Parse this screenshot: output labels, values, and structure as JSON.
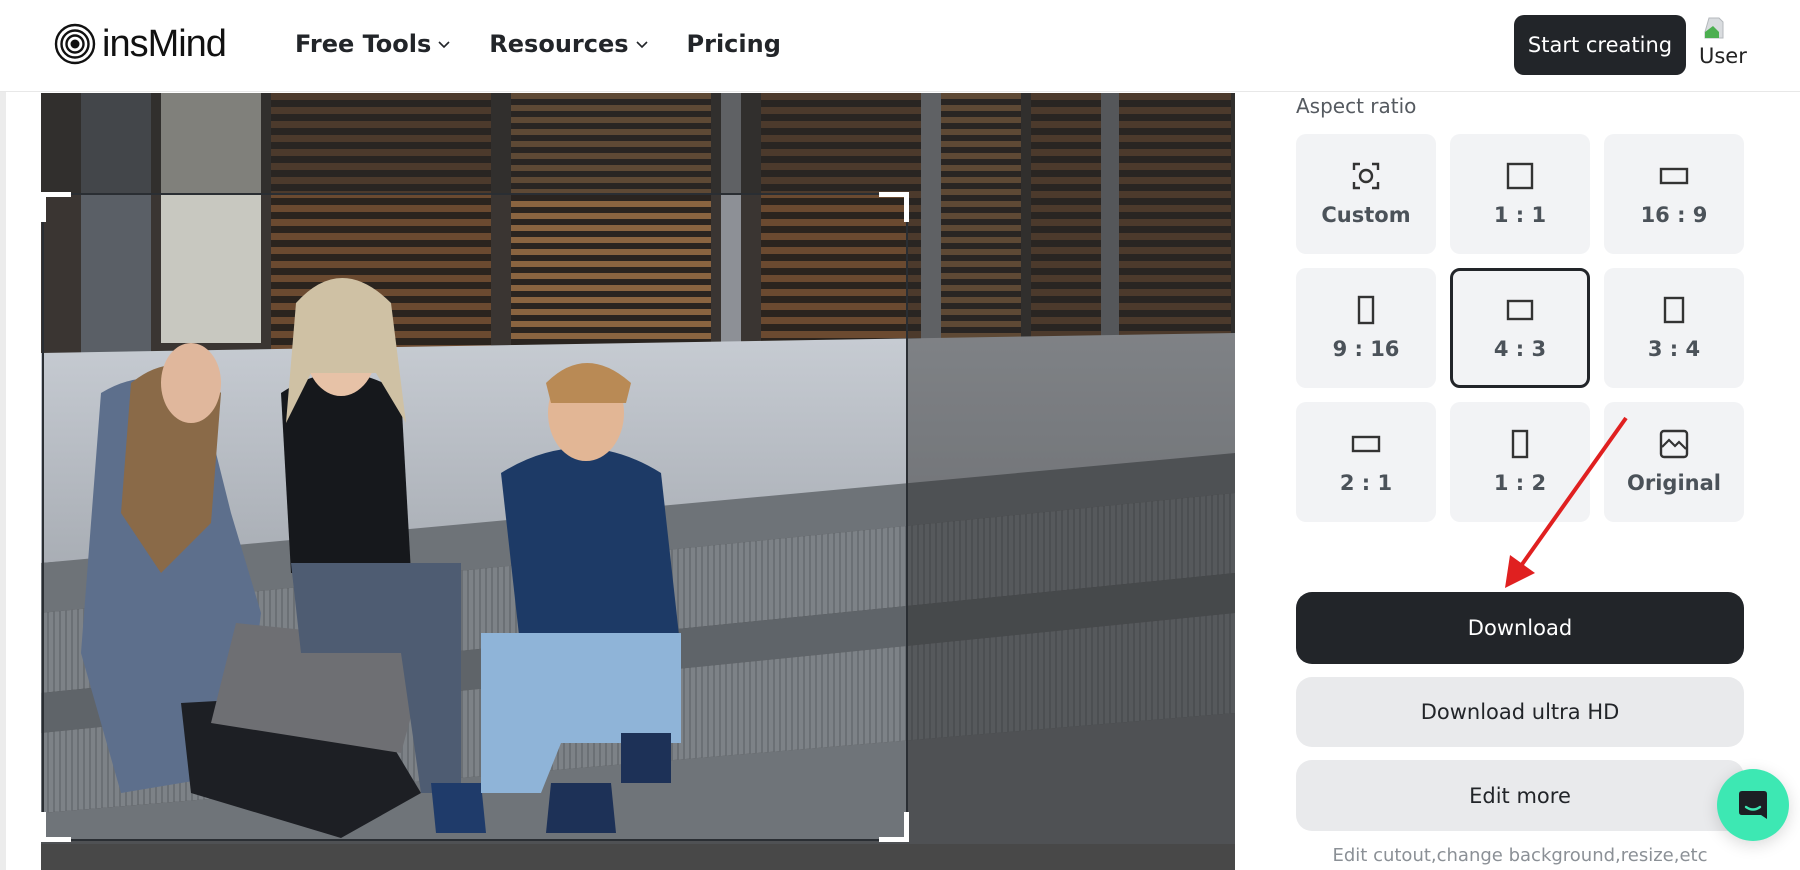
{
  "header": {
    "brand": "insMind",
    "nav": [
      {
        "label": "Free Tools",
        "has_dropdown": true
      },
      {
        "label": "Resources",
        "has_dropdown": true
      },
      {
        "label": "Pricing",
        "has_dropdown": false
      }
    ],
    "cta_label": "Start creating",
    "user_label": "User"
  },
  "editor": {
    "image_description": "Three young people sitting on outdoor concrete steps in front of a building with wooden slatted facade; one woman holds a laptop, one holds a phone",
    "crop_ratio": "4 : 3"
  },
  "panel": {
    "title": "Aspect ratio",
    "ratios": [
      {
        "label": "Custom",
        "icon": "custom-focus-icon",
        "selected": false
      },
      {
        "label": "1 : 1",
        "icon": "square-icon",
        "selected": false
      },
      {
        "label": "16 : 9",
        "icon": "wide-rect-icon",
        "selected": false
      },
      {
        "label": "9 : 16",
        "icon": "tall-rect-icon",
        "selected": false
      },
      {
        "label": "4 : 3",
        "icon": "landscape-rect-icon",
        "selected": true
      },
      {
        "label": "3 : 4",
        "icon": "portrait-rect-icon",
        "selected": false
      },
      {
        "label": "2 : 1",
        "icon": "wide-rect-icon",
        "selected": false
      },
      {
        "label": "1 : 2",
        "icon": "tall-rect-icon",
        "selected": false
      },
      {
        "label": "Original",
        "icon": "image-icon",
        "selected": false
      }
    ],
    "download_label": "Download",
    "download_uhd_label": "Download ultra HD",
    "edit_more_label": "Edit more",
    "footnote": "Edit cutout,change background,resize,etc"
  },
  "colors": {
    "primary_dark": "#222529",
    "tile_bg": "#f2f3f5",
    "secondary_btn_bg": "#e9eaec",
    "chat_accent": "#3de8b3",
    "annotation_arrow": "#e02020"
  }
}
